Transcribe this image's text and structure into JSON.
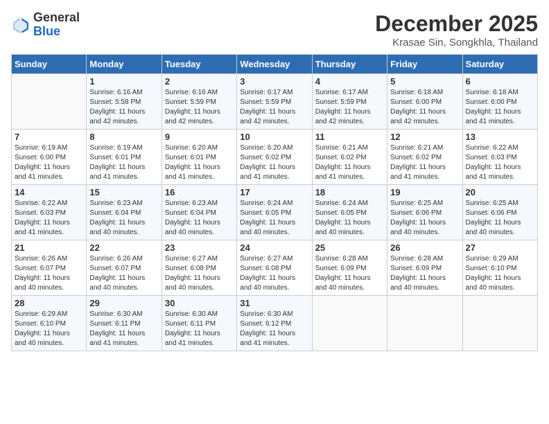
{
  "header": {
    "logo_line1": "General",
    "logo_line2": "Blue",
    "month": "December 2025",
    "location": "Krasae Sin, Songkhla, Thailand"
  },
  "weekdays": [
    "Sunday",
    "Monday",
    "Tuesday",
    "Wednesday",
    "Thursday",
    "Friday",
    "Saturday"
  ],
  "weeks": [
    [
      {
        "day": "",
        "info": ""
      },
      {
        "day": "1",
        "info": "Sunrise: 6:16 AM\nSunset: 5:58 PM\nDaylight: 11 hours\nand 42 minutes."
      },
      {
        "day": "2",
        "info": "Sunrise: 6:16 AM\nSunset: 5:59 PM\nDaylight: 11 hours\nand 42 minutes."
      },
      {
        "day": "3",
        "info": "Sunrise: 6:17 AM\nSunset: 5:59 PM\nDaylight: 11 hours\nand 42 minutes."
      },
      {
        "day": "4",
        "info": "Sunrise: 6:17 AM\nSunset: 5:59 PM\nDaylight: 11 hours\nand 42 minutes."
      },
      {
        "day": "5",
        "info": "Sunrise: 6:18 AM\nSunset: 6:00 PM\nDaylight: 11 hours\nand 42 minutes."
      },
      {
        "day": "6",
        "info": "Sunrise: 6:18 AM\nSunset: 6:00 PM\nDaylight: 11 hours\nand 41 minutes."
      }
    ],
    [
      {
        "day": "7",
        "info": "Sunrise: 6:19 AM\nSunset: 6:00 PM\nDaylight: 11 hours\nand 41 minutes."
      },
      {
        "day": "8",
        "info": "Sunrise: 6:19 AM\nSunset: 6:01 PM\nDaylight: 11 hours\nand 41 minutes."
      },
      {
        "day": "9",
        "info": "Sunrise: 6:20 AM\nSunset: 6:01 PM\nDaylight: 11 hours\nand 41 minutes."
      },
      {
        "day": "10",
        "info": "Sunrise: 6:20 AM\nSunset: 6:02 PM\nDaylight: 11 hours\nand 41 minutes."
      },
      {
        "day": "11",
        "info": "Sunrise: 6:21 AM\nSunset: 6:02 PM\nDaylight: 11 hours\nand 41 minutes."
      },
      {
        "day": "12",
        "info": "Sunrise: 6:21 AM\nSunset: 6:02 PM\nDaylight: 11 hours\nand 41 minutes."
      },
      {
        "day": "13",
        "info": "Sunrise: 6:22 AM\nSunset: 6:03 PM\nDaylight: 11 hours\nand 41 minutes."
      }
    ],
    [
      {
        "day": "14",
        "info": "Sunrise: 6:22 AM\nSunset: 6:03 PM\nDaylight: 11 hours\nand 41 minutes."
      },
      {
        "day": "15",
        "info": "Sunrise: 6:23 AM\nSunset: 6:04 PM\nDaylight: 11 hours\nand 40 minutes."
      },
      {
        "day": "16",
        "info": "Sunrise: 6:23 AM\nSunset: 6:04 PM\nDaylight: 11 hours\nand 40 minutes."
      },
      {
        "day": "17",
        "info": "Sunrise: 6:24 AM\nSunset: 6:05 PM\nDaylight: 11 hours\nand 40 minutes."
      },
      {
        "day": "18",
        "info": "Sunrise: 6:24 AM\nSunset: 6:05 PM\nDaylight: 11 hours\nand 40 minutes."
      },
      {
        "day": "19",
        "info": "Sunrise: 6:25 AM\nSunset: 6:06 PM\nDaylight: 11 hours\nand 40 minutes."
      },
      {
        "day": "20",
        "info": "Sunrise: 6:25 AM\nSunset: 6:06 PM\nDaylight: 11 hours\nand 40 minutes."
      }
    ],
    [
      {
        "day": "21",
        "info": "Sunrise: 6:26 AM\nSunset: 6:07 PM\nDaylight: 11 hours\nand 40 minutes."
      },
      {
        "day": "22",
        "info": "Sunrise: 6:26 AM\nSunset: 6:07 PM\nDaylight: 11 hours\nand 40 minutes."
      },
      {
        "day": "23",
        "info": "Sunrise: 6:27 AM\nSunset: 6:08 PM\nDaylight: 11 hours\nand 40 minutes."
      },
      {
        "day": "24",
        "info": "Sunrise: 6:27 AM\nSunset: 6:08 PM\nDaylight: 11 hours\nand 40 minutes."
      },
      {
        "day": "25",
        "info": "Sunrise: 6:28 AM\nSunset: 6:09 PM\nDaylight: 11 hours\nand 40 minutes."
      },
      {
        "day": "26",
        "info": "Sunrise: 6:28 AM\nSunset: 6:09 PM\nDaylight: 11 hours\nand 40 minutes."
      },
      {
        "day": "27",
        "info": "Sunrise: 6:29 AM\nSunset: 6:10 PM\nDaylight: 11 hours\nand 40 minutes."
      }
    ],
    [
      {
        "day": "28",
        "info": "Sunrise: 6:29 AM\nSunset: 6:10 PM\nDaylight: 11 hours\nand 40 minutes."
      },
      {
        "day": "29",
        "info": "Sunrise: 6:30 AM\nSunset: 6:11 PM\nDaylight: 11 hours\nand 41 minutes."
      },
      {
        "day": "30",
        "info": "Sunrise: 6:30 AM\nSunset: 6:11 PM\nDaylight: 11 hours\nand 41 minutes."
      },
      {
        "day": "31",
        "info": "Sunrise: 6:30 AM\nSunset: 6:12 PM\nDaylight: 11 hours\nand 41 minutes."
      },
      {
        "day": "",
        "info": ""
      },
      {
        "day": "",
        "info": ""
      },
      {
        "day": "",
        "info": ""
      }
    ]
  ]
}
